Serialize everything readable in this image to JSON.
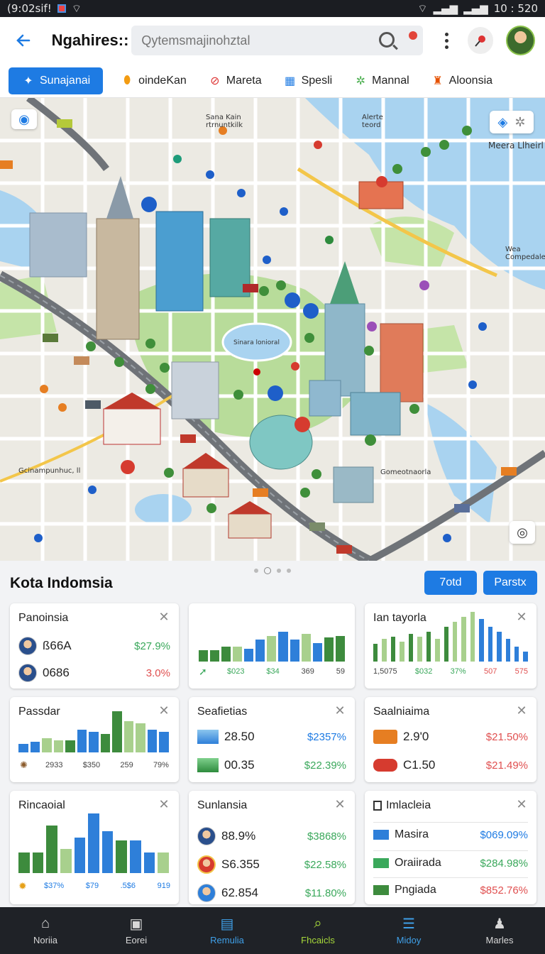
{
  "status": {
    "time": "(9:02sif!",
    "right": "10 : 520"
  },
  "app_bar": {
    "title": "Ngahires::",
    "search_placeholder": "Qytemsmajinohztal"
  },
  "chips": [
    {
      "label": "Sunajanai",
      "icon": "star-icon"
    },
    {
      "label": "oindeKan",
      "icon": "pin-icon"
    },
    {
      "label": "Mareta",
      "icon": "restaurant-icon"
    },
    {
      "label": "Spesli",
      "icon": "building-icon"
    },
    {
      "label": "Mannal",
      "icon": "park-icon"
    },
    {
      "label": "Aloonsia",
      "icon": "hotel-icon"
    }
  ],
  "map": {
    "labels": {
      "top_center": "Sana Kain\nrtrnuntkilk",
      "top_right_a": "Alerte\nteord",
      "top_right_b": "Meera Llheirl",
      "mid_right": "Wea\nCompedale",
      "plaza": "Sinara lonioral",
      "left_bottom": "Gcinampunhuc, ll",
      "right_bottom": "Gomeotnaorla"
    }
  },
  "section": {
    "title": "Kota Indomsia",
    "btn1": "7otd",
    "btn2": "Parstx"
  },
  "cards": {
    "c1": {
      "title": "Panoinsia",
      "rows": [
        {
          "value": "ß66A",
          "pct": "$27.9%"
        },
        {
          "value": "0686",
          "pct": "3.0%"
        }
      ]
    },
    "c2": {
      "axis": [
        "$023",
        "$34",
        "369",
        "59"
      ],
      "bars": [
        0.3,
        0.3,
        0.4,
        0.4,
        0.35,
        0.6,
        0.7,
        0.8,
        0.6,
        0.75,
        0.5,
        0.65,
        0.7
      ]
    },
    "c3": {
      "title": "Ian tayorla",
      "axis": [
        "1,5075",
        "$032",
        "37%",
        "507",
        "575"
      ],
      "bars": [
        0.35,
        0.45,
        0.5,
        0.4,
        0.55,
        0.5,
        0.6,
        0.45,
        0.7,
        0.8,
        0.9,
        1.0,
        0.85,
        0.7,
        0.6,
        0.45,
        0.3,
        0.2
      ]
    },
    "c4": {
      "title": "Passdar",
      "axis": [
        "2933",
        "$350",
        "259",
        "79%"
      ],
      "bars": [
        0.2,
        0.25,
        0.35,
        0.3,
        0.3,
        0.55,
        0.5,
        0.45,
        1.0,
        0.75,
        0.7,
        0.55,
        0.5
      ]
    },
    "c5": {
      "title": "Seafietias",
      "rows": [
        {
          "value": "28.50",
          "pct": "$2357%"
        },
        {
          "value": "00.35",
          "pct": "$22.39%"
        }
      ]
    },
    "c6": {
      "title": "Saalniaima",
      "rows": [
        {
          "value": "2.9'0",
          "pct": "$21.50%"
        },
        {
          "value": "C1.50",
          "pct": "$21.49%"
        }
      ]
    },
    "c7": {
      "title": "Rincaoial",
      "axis": [
        "$37%",
        "$79",
        ".5$6",
        "919"
      ],
      "bars": [
        0.35,
        0.35,
        0.8,
        0.4,
        0.6,
        1.0,
        0.7,
        0.55,
        0.55,
        0.35,
        0.35
      ]
    },
    "c8": {
      "title": "Sunlansia",
      "rows": [
        {
          "value": "88.9%",
          "pct": "$3868%"
        },
        {
          "value": "S6.355",
          "pct": "$22.58%"
        },
        {
          "value": "62.854",
          "pct": "$11.80%"
        }
      ]
    },
    "c9": {
      "title": "Imlacleia",
      "rows": [
        {
          "label": "Masira",
          "pct": "$069.09%"
        },
        {
          "label": "Oraiirada",
          "pct": "$284.98%"
        },
        {
          "label": "Pngiada",
          "pct": "$852.76%"
        }
      ]
    }
  },
  "nav": [
    "Noriia",
    "Eorei",
    "Remulia",
    "Fhcaicls",
    "Midoy",
    "Marles"
  ],
  "colors": {
    "accent": "#1e7be3",
    "positive": "#3aa85b",
    "negative": "#e05050",
    "bar_dark_green": "#3d8b3d",
    "bar_light_green": "#a8d08d",
    "bar_blue": "#2e7fd9"
  }
}
